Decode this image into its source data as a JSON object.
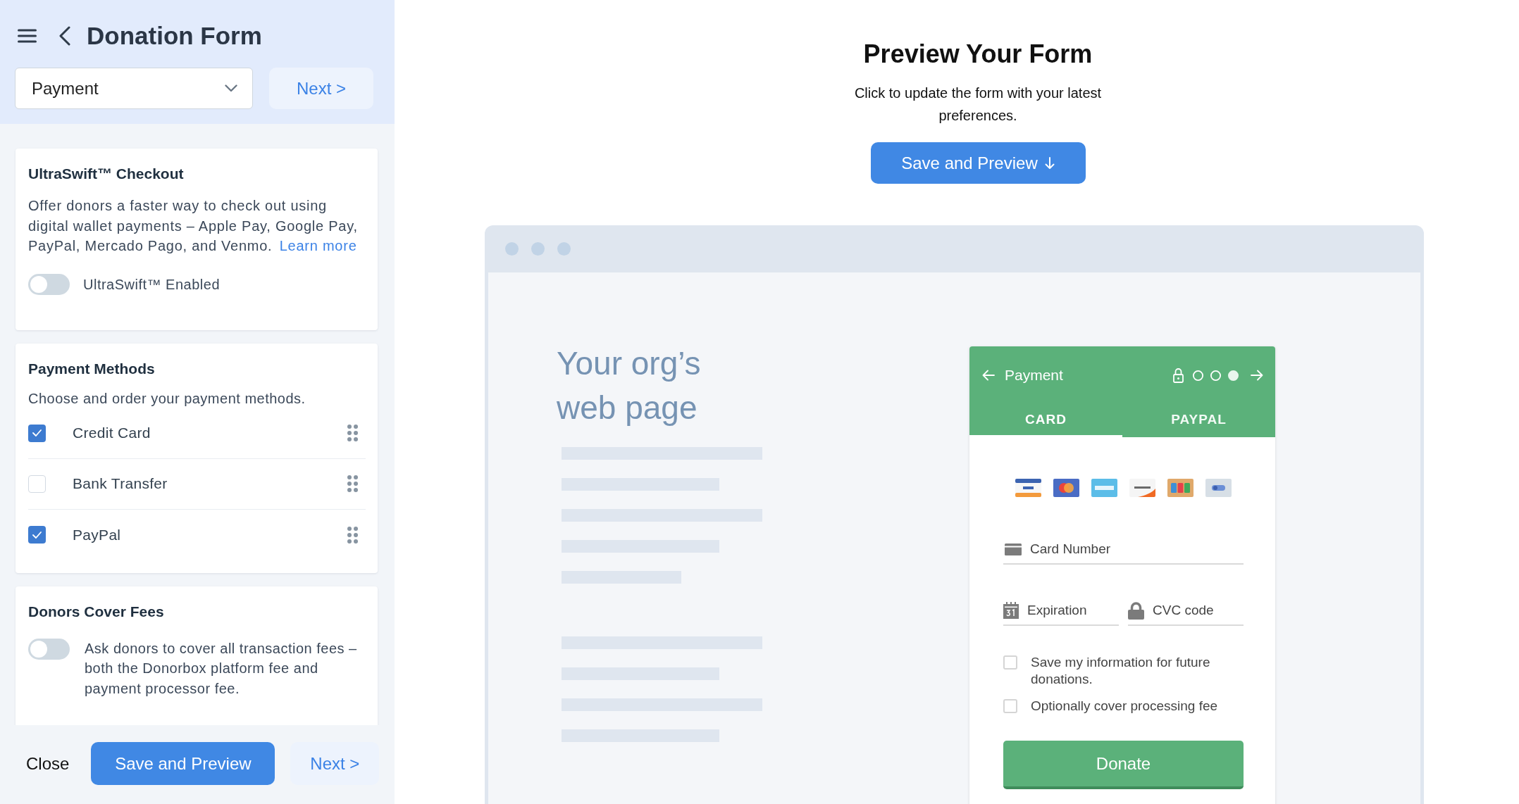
{
  "sidebar": {
    "title": "Donation Form",
    "step_select": {
      "value": "Payment"
    },
    "next_button": "Next >",
    "sections": [
      {
        "kind": "toggle_info",
        "title": "UltraSwift™ Checkout",
        "description": "Offer donors a faster way to check out using digital wallet payments – Apple Pay, Google Pay, PayPal, Mercado Pago, and Venmo.",
        "link": "Learn more",
        "toggle": {
          "label": "UltraSwift™ Enabled",
          "on": false
        }
      },
      {
        "kind": "checklist",
        "title": "Payment Methods",
        "description": "Choose and order your payment methods.",
        "methods": [
          {
            "label": "Credit Card",
            "checked": true
          },
          {
            "label": "Bank Transfer",
            "checked": false
          },
          {
            "label": "PayPal",
            "checked": true
          }
        ]
      },
      {
        "kind": "toggle_text",
        "title": "Donors Cover Fees",
        "toggle": {
          "label": "Ask donors to cover all transaction fees – both the Donorbox platform fee and payment processor fee.",
          "on": false
        }
      }
    ],
    "footer": {
      "close_button": "Close",
      "save_button": "Save and Preview",
      "next_button": "Next >"
    }
  },
  "preview": {
    "title": "Preview Your Form",
    "subtitle": "Click to update the form with your latest preferences.",
    "save_button": "Save and Preview",
    "mock_page": {
      "heading": "Your org’s web page"
    },
    "widget": {
      "title": "Payment",
      "steps": [
        {
          "selected": false
        },
        {
          "selected": false
        },
        {
          "selected": true
        }
      ],
      "tabs": [
        {
          "label": "CARD",
          "selected": true
        },
        {
          "label": "PAYPAL",
          "selected": false
        }
      ],
      "fields": [
        {
          "kind": "card",
          "placeholder": "Card Number"
        },
        {
          "kind": "date",
          "placeholder": "Expiration"
        },
        {
          "kind": "code",
          "placeholder": "CVC code"
        }
      ],
      "options": [
        {
          "label": "Save my information for future donations.",
          "checked": false
        },
        {
          "label": "Optionally cover processing fee",
          "checked": false
        }
      ],
      "donate_button": "Donate"
    }
  }
}
